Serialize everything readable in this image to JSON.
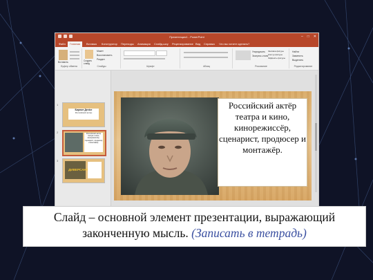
{
  "app": {
    "window_title": "Презентация1 - PowerPoint",
    "accent": "#b7472a"
  },
  "tabs": [
    "Файл",
    "Главная",
    "Вставка",
    "Конструктор",
    "Переходы",
    "Анимация",
    "Слайд-шоу",
    "Рецензирование",
    "Вид",
    "Справка",
    "Что вы хотите сделать?"
  ],
  "ribbon": {
    "groups": [
      "Буфер обмена",
      "Слайды",
      "Шрифт",
      "Абзац",
      "Рисование",
      "Редактирование"
    ],
    "buttons": {
      "paste": "Вставить",
      "new_slide": "Создать слайд",
      "restore": "Восстановить",
      "section": "Раздел",
      "layout": "Макет",
      "find": "Найти",
      "replace": "Заменить",
      "select": "Выделить",
      "arrange": "Упорядочить",
      "quick_styles": "Экспресс-стили",
      "fill": "Заливка фигуры",
      "outline": "Контур фигуры",
      "effects": "Эффекты фигуры"
    }
  },
  "thumbnails": [
    {
      "num": "1",
      "line1": "Бирюкт Денiсе",
      "line2": "Российский актёр"
    },
    {
      "num": "2",
      "line1": "Российский актёр театра и кино, кинорежиссёр, сценарист, продюсер и монтажёр."
    },
    {
      "num": "3",
      "line1": "ДИВЕРСАНТ"
    }
  ],
  "slide": {
    "caption": "Российский актёр театра и кино, кинорежиссёр, сценарист, продюсер и монтажёр."
  },
  "banner": {
    "main": "Слайд – основной элемент презентации, выражающий законченную мысль. ",
    "note": "(Записать в тетрадь)"
  }
}
